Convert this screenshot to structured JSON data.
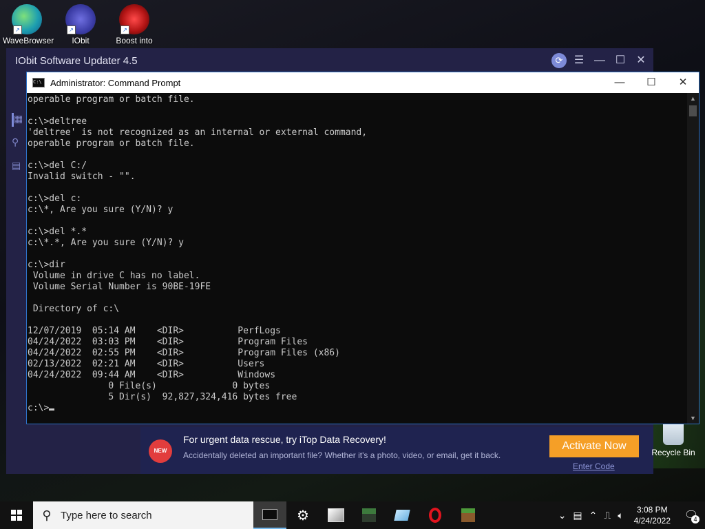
{
  "desktop": {
    "icons": [
      {
        "label": "WaveBrowser",
        "icon": "wavebrowser-icon"
      },
      {
        "label": "IObit",
        "icon": "iobit-icon"
      },
      {
        "label": "Boost into",
        "icon": "boost-icon"
      }
    ],
    "recycle_bin": {
      "label": "Recycle Bin"
    }
  },
  "iobit": {
    "title": "IObit Software Updater 4.5",
    "promo": {
      "badge": "NEW",
      "title": "For urgent data rescue, try iTop Data Recovery!",
      "subtitle": "Accidentally deleted an important file? Whether it's a photo, video, or email, get it back.",
      "activate_label": "Activate Now",
      "enter_code_label": "Enter Code"
    }
  },
  "cmd": {
    "title": "Administrator: Command Prompt",
    "icon_text": "C:\\",
    "console_text": "operable program or batch file.\n\nc:\\>deltree\n'deltree' is not recognized as an internal or external command,\noperable program or batch file.\n\nc:\\>del C:/\nInvalid switch - \"\".\n\nc:\\>del c:\nc:\\*, Are you sure (Y/N)? y\n\nc:\\>del *.*\nc:\\*.*, Are you sure (Y/N)? y\n\nc:\\>dir\n Volume in drive C has no label.\n Volume Serial Number is 90BE-19FE\n\n Directory of c:\\\n\n12/07/2019  05:14 AM    <DIR>          PerfLogs\n04/24/2022  03:03 PM    <DIR>          Program Files\n04/24/2022  02:55 PM    <DIR>          Program Files (x86)\n02/13/2022  02:21 AM    <DIR>          Users\n04/24/2022  09:44 AM    <DIR>          Windows\n               0 File(s)              0 bytes\n               5 Dir(s)  92,827,324,416 bytes free\n",
    "prompt": "c:\\>"
  },
  "taskbar": {
    "search_placeholder": "Type here to search",
    "apps": [
      "command-prompt-icon",
      "settings-icon",
      "photos-icon",
      "minecraft-icon",
      "notes-icon",
      "opera-icon",
      "minecraft-launcher-icon"
    ],
    "time": "3:08 PM",
    "date": "4/24/2022",
    "notification_count": "4"
  },
  "colors": {
    "accent": "#2e72c7",
    "iobit_bg": "#232246",
    "activate": "#f59f27"
  }
}
